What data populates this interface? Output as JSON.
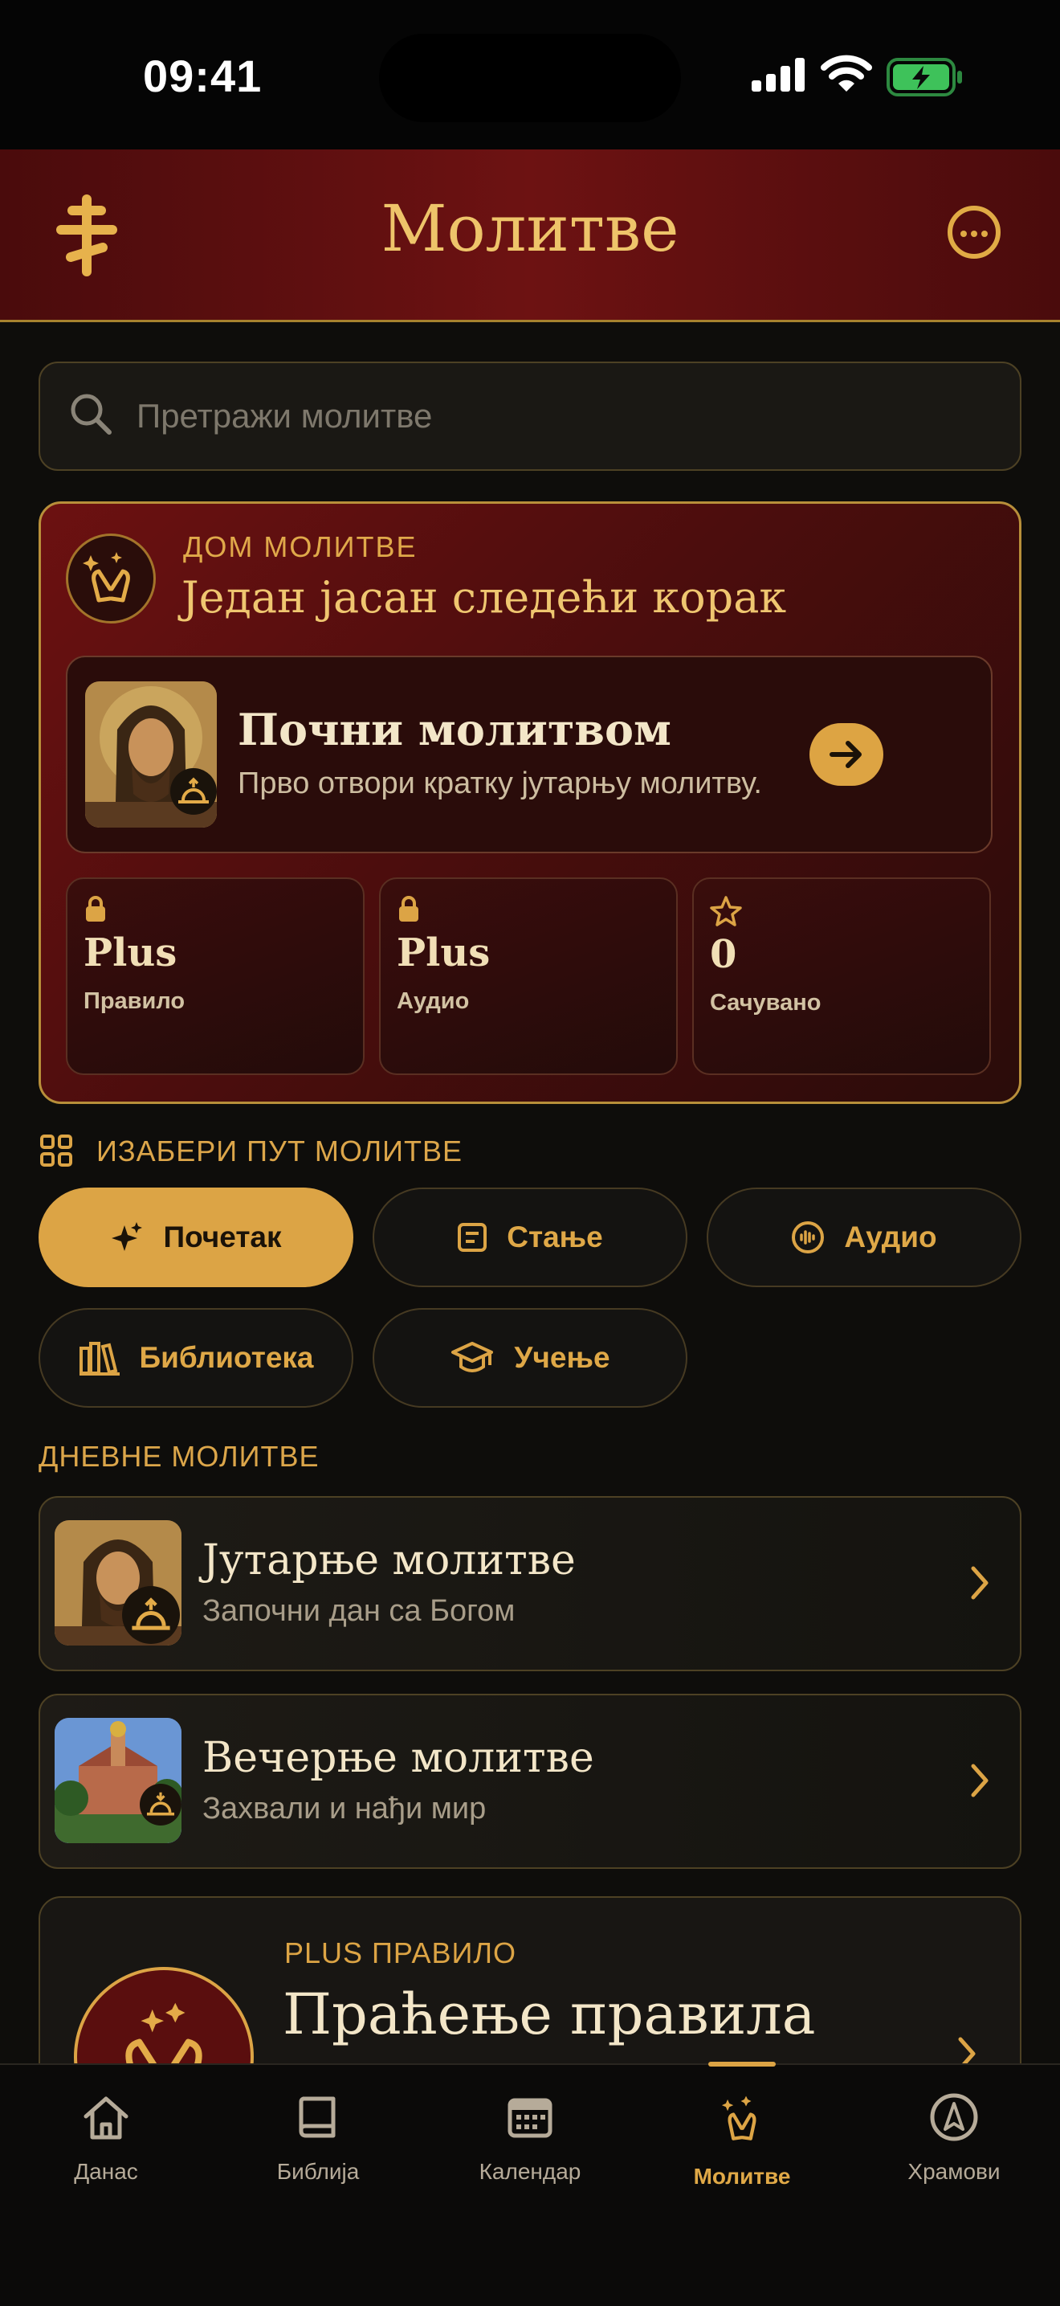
{
  "status_bar": {
    "time": "09:41"
  },
  "header": {
    "title": "Молитве"
  },
  "search": {
    "placeholder": "Претражи молитве"
  },
  "hero": {
    "kicker": "ДОМ МОЛИТВЕ",
    "title": "Један јасан следећи корак",
    "start": {
      "title": "Почни молитвом",
      "subtitle": "Прво отвори кратку јутарњу молитву."
    },
    "stats": [
      {
        "value": "Plus",
        "label": "Правило",
        "icon": "lock-icon"
      },
      {
        "value": "Plus",
        "label": "Аудио",
        "icon": "lock-icon"
      },
      {
        "value": "0",
        "label": "Сачувано",
        "icon": "star-icon"
      }
    ]
  },
  "paths": {
    "label": "ИЗАБЕРИ ПУТ МОЛИТВЕ",
    "chips": [
      {
        "label": "Почетак",
        "icon": "sparkle-icon",
        "active": true
      },
      {
        "label": "Стање",
        "icon": "note-icon"
      },
      {
        "label": "Аудио",
        "icon": "audio-icon"
      },
      {
        "label": "Библиотека",
        "icon": "books-icon"
      },
      {
        "label": "Учење",
        "icon": "graduation-cap-icon"
      }
    ]
  },
  "daily": {
    "label": "ДНЕВНЕ МОЛИТВЕ",
    "items": [
      {
        "title": "Јутарње молитве",
        "subtitle": "Започни дан са Богом"
      },
      {
        "title": "Вечерње молитве",
        "subtitle": "Захвали и нађи мир"
      }
    ]
  },
  "plus_rule": {
    "kicker": "PLUS ПРАВИЛО",
    "title": "Праћење правила"
  },
  "tabs": [
    {
      "label": "Данас",
      "icon": "home-icon"
    },
    {
      "label": "Библија",
      "icon": "book-icon"
    },
    {
      "label": "Календар",
      "icon": "calendar-icon"
    },
    {
      "label": "Молитве",
      "icon": "praying-hands-icon",
      "active": true
    },
    {
      "label": "Храмови",
      "icon": "compass-icon"
    }
  ],
  "colors": {
    "accent": "#dca445",
    "header_red": "#6d1212",
    "background": "#0e0d0b"
  }
}
